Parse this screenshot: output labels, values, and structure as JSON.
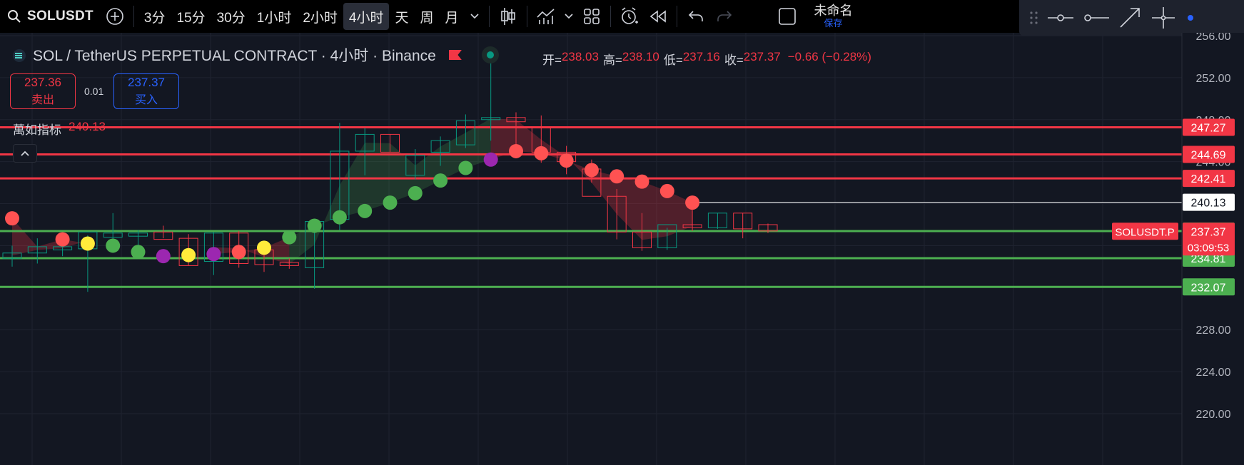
{
  "toolbar": {
    "symbol": "SOLUSDT",
    "intervals": [
      "3分",
      "15分",
      "30分",
      "1小时",
      "2小时",
      "4小时",
      "天",
      "周",
      "月"
    ],
    "active_interval": "4小时",
    "layout_name": "未命名",
    "save_label": "保存"
  },
  "legend": {
    "title": "SOL / TetherUS PERPETUAL CONTRACT · 4小时 · Binance",
    "ohlc": [
      {
        "label": "开=",
        "value": "238.03"
      },
      {
        "label": "高=",
        "value": "238.10"
      },
      {
        "label": "低=",
        "value": "237.16"
      },
      {
        "label": "收=",
        "value": "237.37"
      }
    ],
    "change": "−0.66 (−0.28%)",
    "sell_price": "237.36",
    "sell_label": "卖出",
    "spread": "0.01",
    "buy_price": "237.37",
    "buy_label": "买入",
    "indicator_name": "萬如指标",
    "indicator_value": "240.13"
  },
  "colors": {
    "bg": "#131722",
    "up": "#089981",
    "down": "#f23645",
    "resistance": "#f23645",
    "support": "#4caf50",
    "dot_green": "#4caf50",
    "dot_red": "#ff5252",
    "dot_yellow": "#ffeb3b",
    "dot_purple": "#9c27b0"
  },
  "chart_data": {
    "type": "candlestick",
    "y_axis_ticks": [
      "256.00",
      "252.00",
      "248.00",
      "244.00",
      "228.00",
      "224.00",
      "220.00"
    ],
    "ylim": [
      220,
      256
    ],
    "candles": [
      {
        "o": 234.8,
        "h": 236.0,
        "l": 234.0,
        "c": 235.3
      },
      {
        "o": 235.3,
        "h": 236.7,
        "l": 234.3,
        "c": 235.9
      },
      {
        "o": 235.6,
        "h": 236.4,
        "l": 235.0,
        "c": 235.9
      },
      {
        "o": 235.7,
        "h": 237.0,
        "l": 231.6,
        "c": 237.3
      },
      {
        "o": 236.8,
        "h": 239.1,
        "l": 235.5,
        "c": 237.2
      },
      {
        "o": 236.9,
        "h": 237.5,
        "l": 235.9,
        "c": 237.2
      },
      {
        "o": 237.3,
        "h": 237.9,
        "l": 236.7,
        "c": 236.6
      },
      {
        "o": 236.7,
        "h": 237.1,
        "l": 234.1,
        "c": 234.1
      },
      {
        "o": 234.5,
        "h": 237.3,
        "l": 233.2,
        "c": 237.2
      },
      {
        "o": 237.2,
        "h": 237.4,
        "l": 233.9,
        "c": 234.3
      },
      {
        "o": 235.6,
        "h": 236.0,
        "l": 233.5,
        "c": 234.2
      },
      {
        "o": 234.4,
        "h": 234.8,
        "l": 233.8,
        "c": 234.1
      },
      {
        "o": 233.9,
        "h": 238.3,
        "l": 231.9,
        "c": 238.3
      },
      {
        "o": 238.5,
        "h": 247.7,
        "l": 237.5,
        "c": 245.0
      },
      {
        "o": 245.0,
        "h": 247.2,
        "l": 242.7,
        "c": 246.6
      },
      {
        "o": 246.6,
        "h": 246.6,
        "l": 244.9,
        "c": 244.9
      },
      {
        "o": 242.7,
        "h": 245.2,
        "l": 242.3,
        "c": 244.6
      },
      {
        "o": 244.9,
        "h": 246.4,
        "l": 243.6,
        "c": 246.0
      },
      {
        "o": 245.6,
        "h": 248.5,
        "l": 245.3,
        "c": 247.9
      },
      {
        "o": 248.0,
        "h": 253.6,
        "l": 246.0,
        "c": 248.2
      },
      {
        "o": 248.2,
        "h": 248.7,
        "l": 244.7,
        "c": 247.8
      },
      {
        "o": 247.3,
        "h": 248.4,
        "l": 243.9,
        "c": 244.9
      },
      {
        "o": 244.9,
        "h": 245.5,
        "l": 242.8,
        "c": 244.0
      },
      {
        "o": 243.3,
        "h": 244.2,
        "l": 242.0,
        "c": 240.7
      },
      {
        "o": 240.7,
        "h": 241.4,
        "l": 236.6,
        "c": 237.3
      },
      {
        "o": 237.3,
        "h": 239.1,
        "l": 235.5,
        "c": 235.8
      },
      {
        "o": 235.8,
        "h": 237.7,
        "l": 235.6,
        "c": 238.0
      },
      {
        "o": 238.0,
        "h": 239.4,
        "l": 237.4,
        "c": 237.7
      },
      {
        "o": 237.7,
        "h": 239.1,
        "l": 237.6,
        "c": 239.1
      },
      {
        "o": 239.1,
        "h": 239.1,
        "l": 236.7,
        "c": 237.6
      },
      {
        "o": 238.0,
        "h": 238.1,
        "l": 237.2,
        "c": 237.4
      }
    ],
    "dots": [
      {
        "i": 0,
        "y": 238.6,
        "color": "red"
      },
      {
        "i": 2,
        "y": 236.6,
        "color": "red"
      },
      {
        "i": 3,
        "y": 236.2,
        "color": "yellow"
      },
      {
        "i": 4,
        "y": 236.0,
        "color": "green"
      },
      {
        "i": 5,
        "y": 235.4,
        "color": "green"
      },
      {
        "i": 6,
        "y": 235.0,
        "color": "purple"
      },
      {
        "i": 7,
        "y": 235.1,
        "color": "yellow"
      },
      {
        "i": 8,
        "y": 235.2,
        "color": "purple"
      },
      {
        "i": 9,
        "y": 235.4,
        "color": "red"
      },
      {
        "i": 10,
        "y": 235.8,
        "color": "yellow"
      },
      {
        "i": 11,
        "y": 236.8,
        "color": "green"
      },
      {
        "i": 12,
        "y": 237.9,
        "color": "green"
      },
      {
        "i": 13,
        "y": 238.7,
        "color": "green"
      },
      {
        "i": 14,
        "y": 239.3,
        "color": "green"
      },
      {
        "i": 15,
        "y": 240.1,
        "color": "green"
      },
      {
        "i": 16,
        "y": 241.0,
        "color": "green"
      },
      {
        "i": 17,
        "y": 242.2,
        "color": "green"
      },
      {
        "i": 18,
        "y": 243.4,
        "color": "green"
      },
      {
        "i": 19,
        "y": 244.2,
        "color": "purple"
      },
      {
        "i": 20,
        "y": 245.0,
        "color": "red"
      },
      {
        "i": 21,
        "y": 244.8,
        "color": "red"
      },
      {
        "i": 22,
        "y": 244.1,
        "color": "red"
      },
      {
        "i": 23,
        "y": 243.2,
        "color": "red"
      },
      {
        "i": 24,
        "y": 242.6,
        "color": "red"
      },
      {
        "i": 25,
        "y": 242.1,
        "color": "red"
      },
      {
        "i": 26,
        "y": 241.2,
        "color": "red"
      },
      {
        "i": 27,
        "y": 240.1,
        "color": "red"
      }
    ],
    "levels": [
      {
        "value": 247.27,
        "label": "247.27",
        "kind": "resistance"
      },
      {
        "value": 244.69,
        "label": "244.69",
        "kind": "resistance"
      },
      {
        "value": 242.41,
        "label": "242.41",
        "kind": "resistance"
      },
      {
        "value": 237.39,
        "label": "237.39",
        "kind": "support"
      },
      {
        "value": 234.81,
        "label": "234.81",
        "kind": "support"
      },
      {
        "value": 232.07,
        "label": "232.07",
        "kind": "support"
      }
    ],
    "indicator_line": {
      "value": 240.13,
      "label": "240.13"
    },
    "last_price": {
      "value": 237.37,
      "label": "237.37",
      "countdown": "03:09:53",
      "symbol_tag": "SOLUSDT.P"
    }
  }
}
